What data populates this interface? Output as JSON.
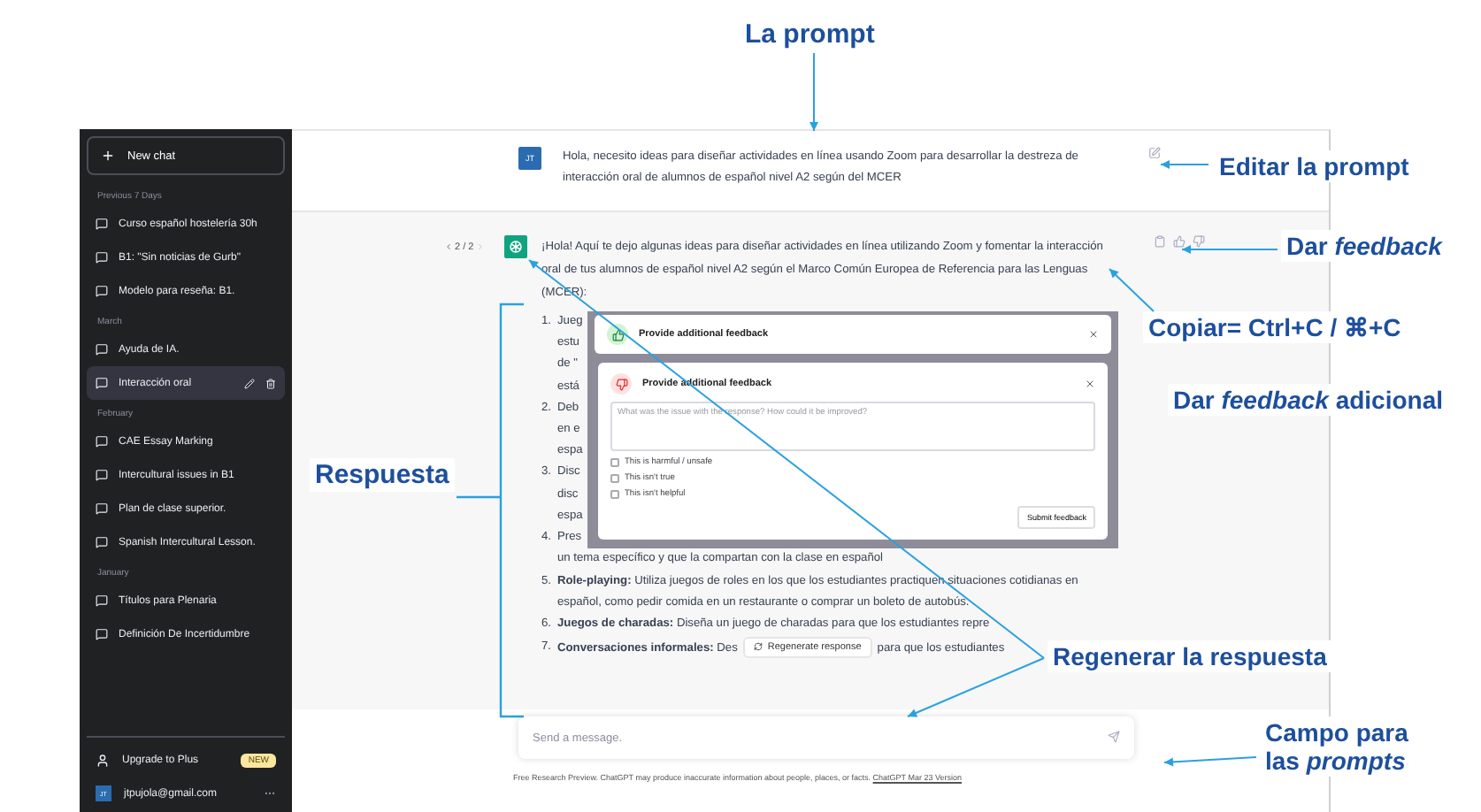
{
  "annotations": [
    {
      "text": "La prompt"
    },
    {
      "text": "Editar la prompt"
    },
    {
      "text": "Dar *feedback*"
    },
    {
      "text": "Copiar= Ctrl+C / ⌘+C"
    },
    {
      "text": "Dar *feedback* adicional"
    },
    {
      "text": "Respuesta"
    },
    {
      "text": "Regenerar la respuesta"
    },
    {
      "text": "Campo para las *prompts*"
    }
  ],
  "sidebar": {
    "new_chat": "New chat",
    "groups": [
      {
        "label": "Previous 7 Days",
        "items": [
          {
            "title": "Curso español hostelería 30h",
            "selected": false
          },
          {
            "title": "B1: \"Sin noticias de Gurb\"",
            "selected": false
          },
          {
            "title": "Modelo para reseña: B1.",
            "selected": false
          }
        ]
      },
      {
        "label": "March",
        "items": [
          {
            "title": "Ayuda de IA.",
            "selected": false
          },
          {
            "title": "Interacción oral",
            "selected": true
          }
        ]
      },
      {
        "label": "February",
        "items": [
          {
            "title": "CAE Essay Marking",
            "selected": false
          },
          {
            "title": "Intercultural issues in B1",
            "selected": false
          },
          {
            "title": "Plan de clase superior.",
            "selected": false
          },
          {
            "title": "Spanish Intercultural Lesson.",
            "selected": false
          }
        ]
      },
      {
        "label": "January",
        "items": [
          {
            "title": "Títulos para Plenaria",
            "selected": false
          },
          {
            "title": "Definición De Incertidumbre",
            "selected": false
          }
        ]
      }
    ],
    "upgrade": {
      "label": "Upgrade to Plus",
      "badge": "NEW"
    },
    "account": {
      "initials": "JT",
      "email": "jtpujola@gmail.com"
    }
  },
  "conversation": {
    "user_message": {
      "initials": "JT",
      "text": "Hola, necesito ideas para diseñar actividades en línea usando Zoom para desarrollar la destreza de interacción oral de alumnos de español nivel A2 según del MCER"
    },
    "assistant": {
      "pager": "2 / 2",
      "intro": "¡Hola! Aquí te dejo algunas ideas para diseñar actividades en línea utilizando Zoom y fomentar la interacción oral de tus alumnos de español nivel A2 según el Marco Común Europea de Referencia para las Lenguas (MCER):",
      "covered_items": [
        {
          "number": "1.",
          "lines": [
            "Jueg",
            "estu",
            "de \"",
            "está"
          ]
        },
        {
          "number": "2.",
          "lines": [
            "Deb",
            "en e",
            "espa"
          ]
        },
        {
          "number": "3.",
          "lines": [
            "Disc",
            "disc",
            "espa"
          ]
        },
        {
          "number": "4.",
          "lines": [
            "Pres"
          ]
        }
      ],
      "continuation": "un tema específico y que la compartan con la clase en español",
      "items": [
        {
          "number": "5.",
          "text": "**Role-playing:** Utiliza juegos de roles en los que los estudiantes practiquen situaciones cotidianas en español, como pedir comida en un restaurante o comprar un boleto de autobús."
        },
        {
          "number": "6.",
          "text": "**Juegos de charadas:** Diseña un juego de charadas para que los estudiantes repre"
        },
        {
          "number": "7.",
          "text": "**Conversaciones informales:** Des",
          "after": "para que los estudiantes"
        }
      ]
    }
  },
  "feedback_dialogs": [
    {
      "kind": "positive",
      "title": "Provide additional feedback"
    },
    {
      "kind": "negative",
      "title": "Provide additional feedback",
      "placeholder": "What was the issue with the response? How could it be improved?",
      "options": [
        {
          "label": "This is harmful / unsafe",
          "checked": false
        },
        {
          "label": "This isn't true",
          "checked": false
        },
        {
          "label": "This isn't helpful",
          "checked": false
        }
      ],
      "submit": "Submit feedback"
    }
  ],
  "regenerate": "Regenerate response",
  "composer": {
    "placeholder": "Send a message."
  },
  "footer": {
    "text": "Free Research Preview. ChatGPT may produce inaccurate information about people, places, or facts.",
    "link": "ChatGPT Mar 23 Version"
  }
}
